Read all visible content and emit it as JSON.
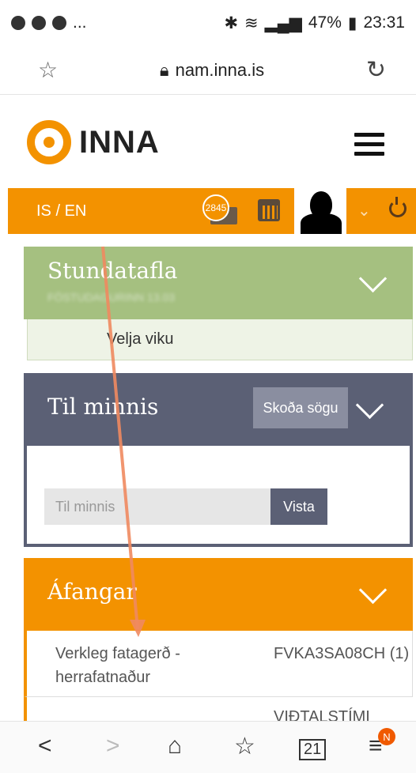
{
  "status": {
    "left_icons": [
      "...",
      ""
    ],
    "battery": "47%",
    "time": "23:31"
  },
  "browser": {
    "url": "nam.inna.is"
  },
  "brand": {
    "logo_text": "INNA"
  },
  "topnav": {
    "lang": "IS / EN",
    "badge_count": "2845"
  },
  "panels": {
    "timetable": {
      "title": "Stundatafla",
      "blurred": "FÖSTUDAGURINN 13.03",
      "body": "Velja viku"
    },
    "notes": {
      "title": "Til minnis",
      "history_button": "Skoða sögu",
      "input_placeholder": "Til minnis",
      "save_button": "Vista"
    },
    "courses": {
      "title": "Áfangar",
      "rows": [
        {
          "name": "Verkleg fatagerð - herrafatnaður",
          "code": "FVKA3SA08CH (1)"
        },
        {
          "name": "",
          "code": "VIÐTALSTÍMI"
        }
      ]
    }
  },
  "bottom": {
    "tabs_count": "21",
    "menu_badge": "N"
  }
}
